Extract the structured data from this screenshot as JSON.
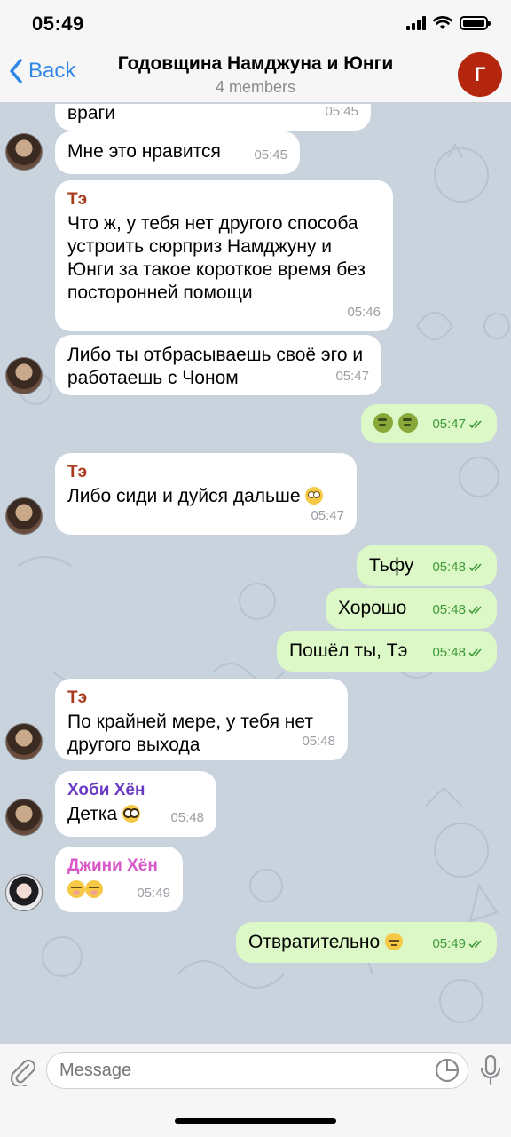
{
  "status_bar": {
    "time": "05:49"
  },
  "header": {
    "back_label": "Back",
    "title": "Годовщина Намджуна и Юнги",
    "subtitle": "4 members",
    "avatar_letter": "Г"
  },
  "messages": [
    {
      "text": "враги",
      "time": "05:45"
    },
    {
      "text": "Мне это нравится",
      "time": "05:45"
    },
    {
      "sender": "Тэ",
      "text": "Что ж, у тебя нет другого способа устроить сюрприз Намджуну и Юнги за такое короткое время без посторонней помощи",
      "time": "05:46"
    },
    {
      "text": "Либо ты отбрасываешь своё эго и работаешь с Чоном",
      "time": "05:47"
    },
    {
      "text": "",
      "time": "05:47",
      "emoji": "nauseated x2"
    },
    {
      "sender": "Тэ",
      "text": "Либо сиди и дуйся дальше",
      "time": "05:47",
      "emoji": "eye-roll"
    },
    {
      "text": "Тьфу",
      "time": "05:48"
    },
    {
      "text": "Хорошо",
      "time": "05:48"
    },
    {
      "text": "Пошёл ты, Тэ",
      "time": "05:48"
    },
    {
      "sender": "Тэ",
      "text": "По крайней мере, у тебя нет другого выхода",
      "time": "05:48"
    },
    {
      "sender": "Хоби Хён",
      "text": "Детка",
      "time": "05:48",
      "emoji": "flushed"
    },
    {
      "sender": "Джини Хён",
      "text": "",
      "time": "05:49",
      "emoji": "giggle x2"
    },
    {
      "text": "Отвратительно",
      "time": "05:49",
      "emoji": "pensive"
    }
  ],
  "input": {
    "placeholder": "Message"
  },
  "colors": {
    "accent": "#2f87e6",
    "sender_te": "#a83a1b",
    "sender_hobi": "#6a3bc7",
    "sender_jin": "#d857c9",
    "outgoing_bubble": "#dcf8c6",
    "outgoing_time": "#3f9a3a"
  }
}
